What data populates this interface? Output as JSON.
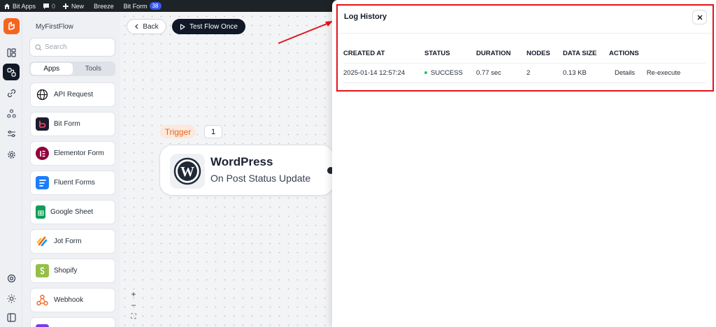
{
  "adminbar": {
    "site_name": "Bit Apps",
    "comments_count": "0",
    "new_label": "New",
    "breeze_label": "Breeze",
    "bitform_label": "Bit Form",
    "bitform_badge": "38"
  },
  "sidebar": {
    "flow_name": "MyFirstFlow",
    "search_placeholder": "Search",
    "tabs": [
      "Apps",
      "Tools"
    ],
    "apps": [
      {
        "label": "API Request",
        "icon": "globe-icon",
        "color": "#ffffff"
      },
      {
        "label": "Bit Form",
        "icon": "bit-form-icon",
        "color": "#1c1c2e"
      },
      {
        "label": "Elementor Form",
        "icon": "elementor-icon",
        "color": "#92003b"
      },
      {
        "label": "Fluent Forms",
        "icon": "fluent-forms-icon",
        "color": "#1a7efb"
      },
      {
        "label": "Google Sheet",
        "icon": "google-sheet-icon",
        "color": "#0f9d58"
      },
      {
        "label": "Jot Form",
        "icon": "jotform-icon",
        "color": "#ff6100"
      },
      {
        "label": "Shopify",
        "icon": "shopify-icon",
        "color": "#95bf47"
      },
      {
        "label": "Webhook",
        "icon": "webhook-icon",
        "color": "#f26522"
      }
    ]
  },
  "toolbar": {
    "back_label": "Back",
    "test_label": "Test Flow Once"
  },
  "flow": {
    "trigger_label": "Trigger",
    "trigger_count": "1",
    "node_title": "WordPress",
    "node_subtitle": "On Post Status Update"
  },
  "zoom": {
    "zoom_in": "+",
    "zoom_out": "−",
    "fit": "⛶"
  },
  "log_history": {
    "title": "Log History",
    "columns": [
      "CREATED AT",
      "STATUS",
      "DURATION",
      "NODES",
      "DATA SIZE",
      "ACTIONS"
    ],
    "rows": [
      {
        "created_at": "2025-01-14 12:57:24",
        "status": "SUCCESS",
        "duration": "0.77 sec",
        "nodes": "2",
        "data_size": "0.13 KB",
        "actions": [
          "Details",
          "Re-execute"
        ]
      }
    ]
  },
  "colors": {
    "brand": "#f5651f",
    "success": "#22c55e",
    "highlight": "#e3121b",
    "dark_button": "#111827"
  }
}
